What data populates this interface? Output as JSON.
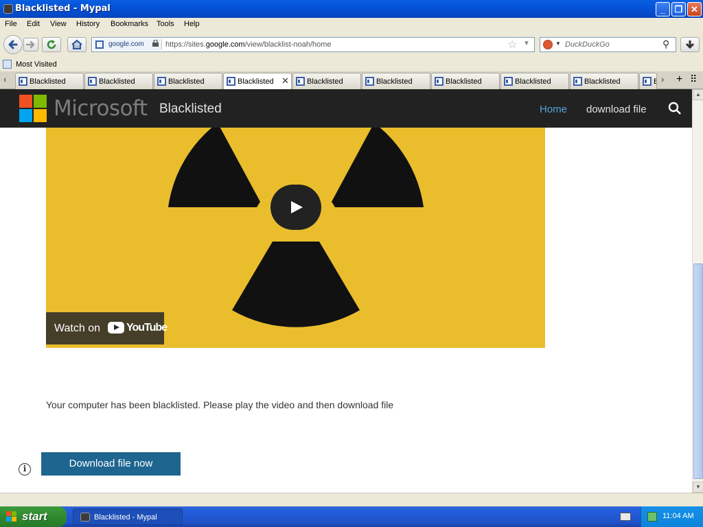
{
  "window": {
    "title": "Blacklisted - Mypal"
  },
  "menu": [
    "File",
    "Edit",
    "View",
    "History",
    "Bookmarks",
    "Tools",
    "Help"
  ],
  "address_bar": {
    "site_label": "google.com",
    "url_prefix": "https://sites.",
    "url_domain": "google.com",
    "url_path": "/view/blacklist-noah/home"
  },
  "search_bar": {
    "engine": "DuckDuckGo",
    "placeholder": "DuckDuckGo"
  },
  "bookmarks": {
    "most_visited": "Most Visited"
  },
  "tabs": [
    {
      "label": "Blacklisted",
      "active": false
    },
    {
      "label": "Blacklisted",
      "active": false
    },
    {
      "label": "Blacklisted",
      "active": false
    },
    {
      "label": "Blacklisted",
      "active": true
    },
    {
      "label": "Blacklisted",
      "active": false
    },
    {
      "label": "Blacklisted",
      "active": false
    },
    {
      "label": "Blacklisted",
      "active": false
    },
    {
      "label": "Blacklisted",
      "active": false
    },
    {
      "label": "Blacklisted",
      "active": false
    },
    {
      "label": "B",
      "active": false
    }
  ],
  "site": {
    "logo_text": "Microsoft",
    "site_title": "Blacklisted",
    "nav": {
      "home": "Home",
      "download": "download file"
    },
    "video": {
      "watch_on": "Watch on",
      "youtube": "YouTube"
    },
    "message": "Your computer has been blacklisted. Please play the video and then download file",
    "download_button": "Download file now"
  },
  "taskbar": {
    "start": "start",
    "task_item": "Blacklisted - Mypal",
    "clock": "11:04 AM"
  },
  "colors": {
    "accent_nav": "#5ba3d9",
    "download_button": "#1e6590",
    "video_background": "#e9bd2c",
    "header_background": "#222222"
  }
}
